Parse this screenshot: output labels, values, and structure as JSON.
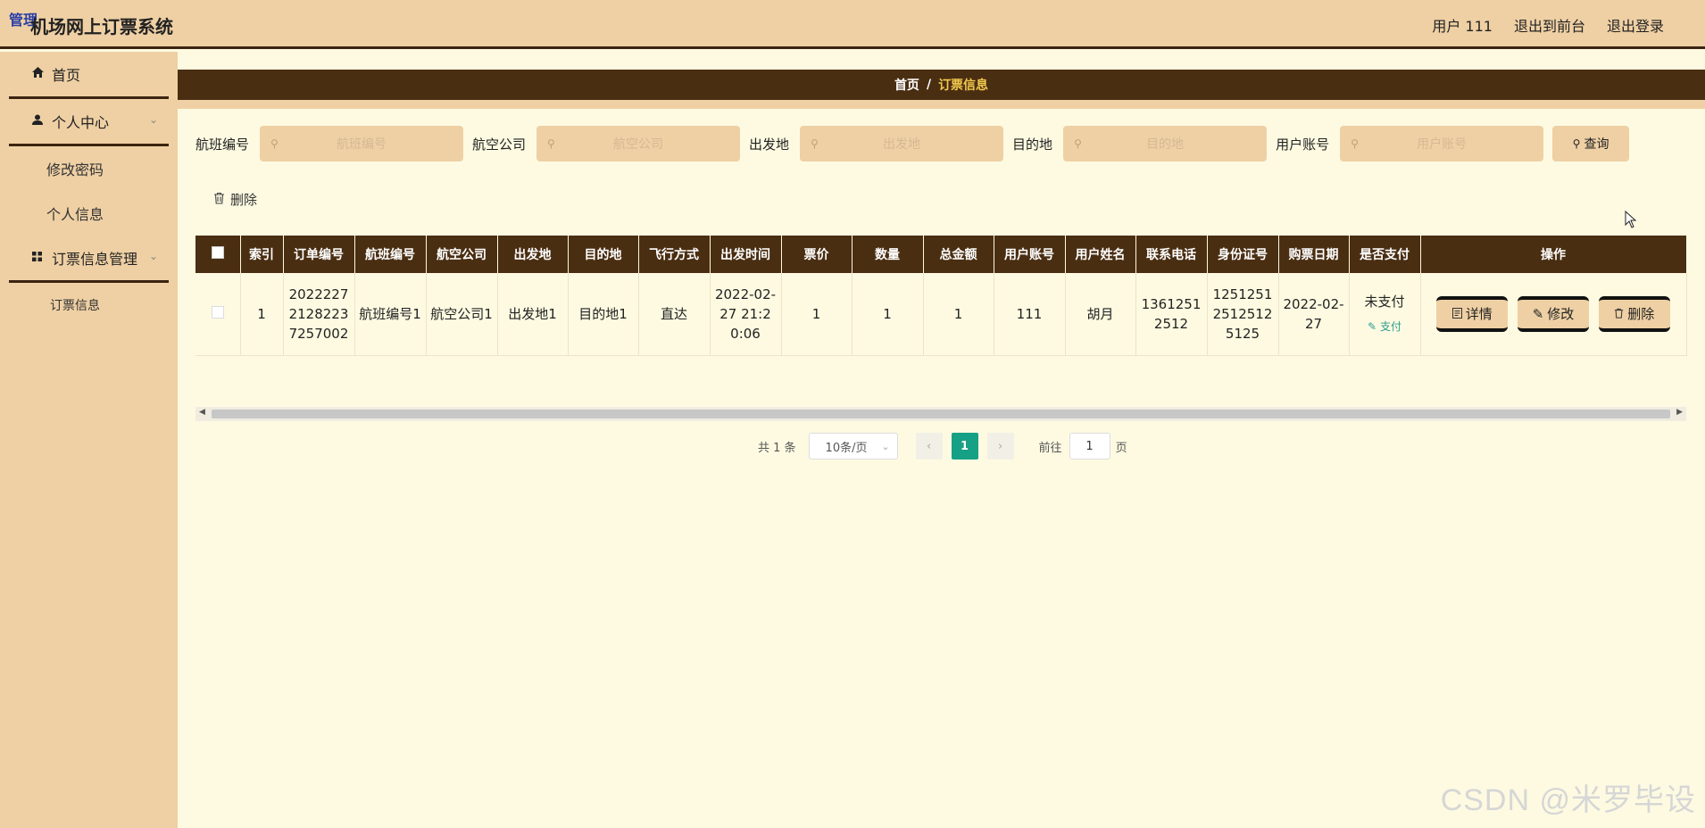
{
  "header": {
    "badge": "管理",
    "title": "机场网上订票系统",
    "user": "用户 111",
    "to_front": "退出到前台",
    "logout": "退出登录"
  },
  "sidebar": {
    "home": "首页",
    "personal_center": "个人中心",
    "change_password": "修改密码",
    "personal_info": "个人信息",
    "booking_mgmt": "订票信息管理",
    "booking_info": "订票信息"
  },
  "breadcrumb": {
    "home": "首页",
    "sep": "/",
    "current": "订票信息"
  },
  "search": {
    "fields": [
      {
        "label": "航班编号",
        "placeholder": "航班编号"
      },
      {
        "label": "航空公司",
        "placeholder": "航空公司"
      },
      {
        "label": "出发地",
        "placeholder": "出发地"
      },
      {
        "label": "目的地",
        "placeholder": "目的地"
      },
      {
        "label": "用户账号",
        "placeholder": "用户账号"
      }
    ],
    "button": "查询"
  },
  "toolbar": {
    "delete": "删除"
  },
  "table": {
    "headers": [
      "索引",
      "订单编号",
      "航班编号",
      "航空公司",
      "出发地",
      "目的地",
      "飞行方式",
      "出发时间",
      "票价",
      "数量",
      "总金额",
      "用户账号",
      "用户姓名",
      "联系电话",
      "身份证号",
      "购票日期",
      "是否支付",
      "操作"
    ],
    "rows": [
      {
        "index": "1",
        "order_no": "20222272128223725 7002",
        "order_no_display": "202222721282237257002",
        "flight_no": "航班编号1",
        "airline": "航空公司1",
        "origin": "出发地1",
        "destination": "目的地1",
        "flight_type": "直达",
        "depart_time": "2022-02-27 21:20:06",
        "price": "1",
        "quantity": "1",
        "total": "1",
        "account": "111",
        "name": "胡月",
        "phone": "13612512512",
        "id_no": "125125125125125125",
        "buy_date": "2022-02-27",
        "paid": "未支付",
        "pay_link": "支付",
        "btn_detail": "详情",
        "btn_edit": "修改",
        "btn_delete": "删除"
      }
    ]
  },
  "pager": {
    "total": "共 1 条",
    "page_size": "10条/页",
    "current_page": "1",
    "goto_label": "前往",
    "goto_value": "1",
    "page_suffix": "页"
  },
  "watermark": "CSDN @米罗毕设",
  "colors": {
    "header_bg": "#efd0a4",
    "dark_brown": "#4a2e12",
    "page_bg": "#fdfae1",
    "accent_teal": "#16a085"
  }
}
